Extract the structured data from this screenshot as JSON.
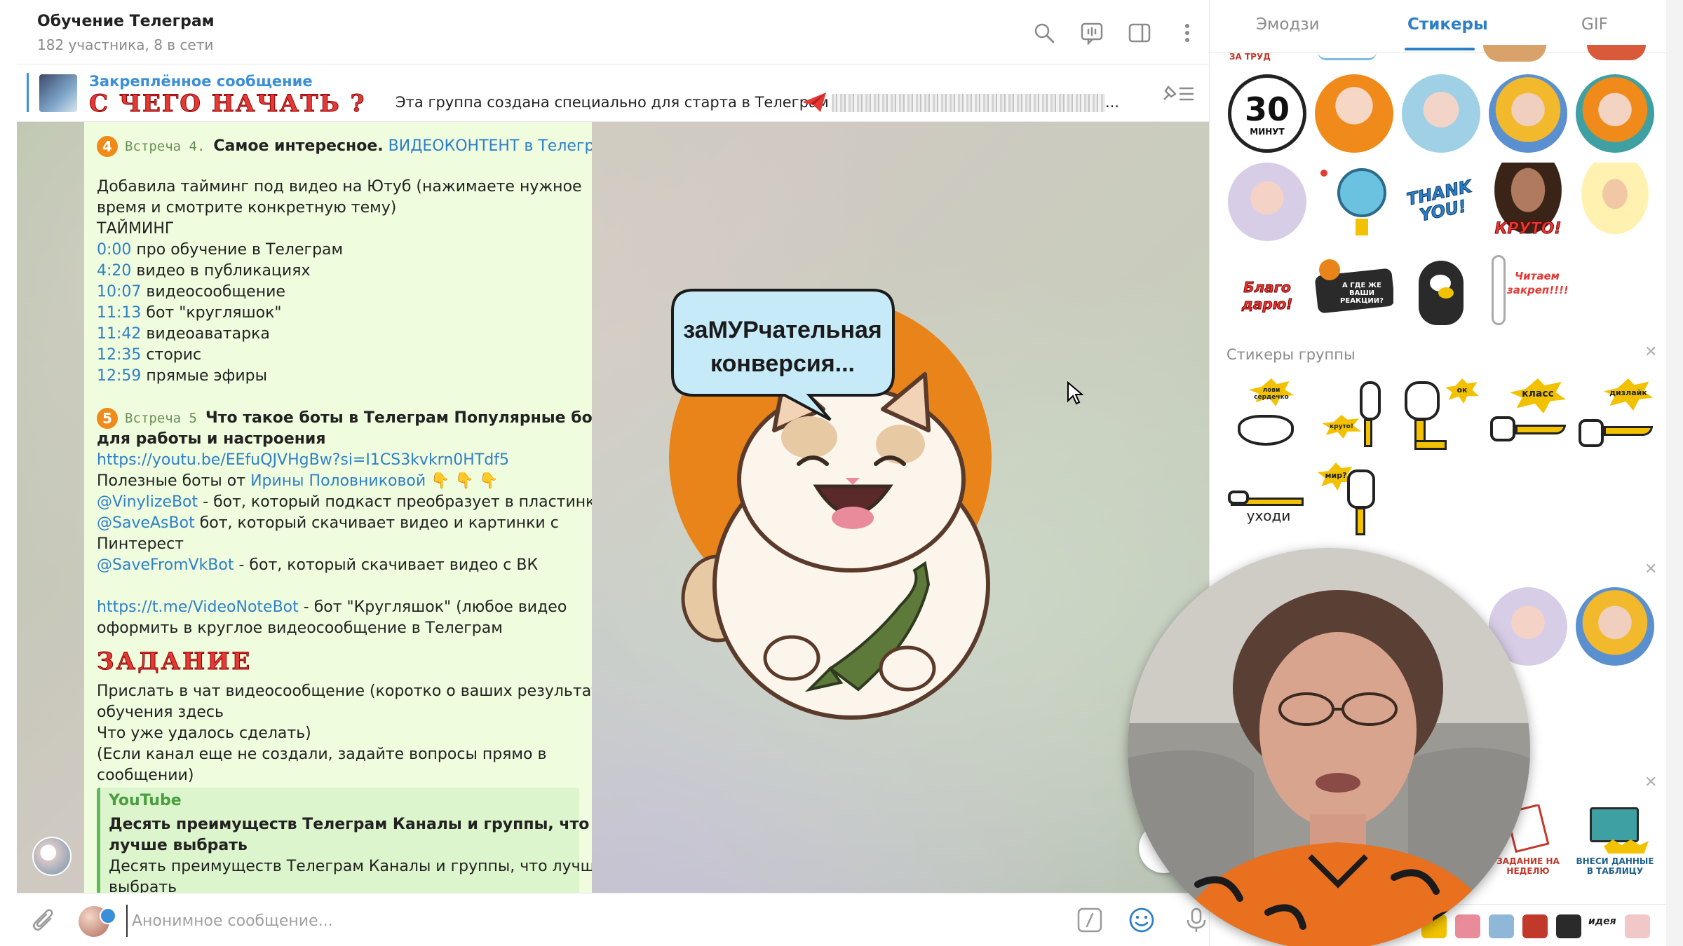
{
  "header": {
    "title": "Обучение Телеграм",
    "subtitle": "182 участника, 8 в сети"
  },
  "pinned": {
    "label": "Закреплённое сообщение",
    "headline": "С ЧЕГО НАЧАТЬ ?",
    "text": "Эта группа создана специально для старта в Телеграм",
    "ellipsis": "..."
  },
  "message": {
    "meet4_badge": "4",
    "meet4_label": "Встреча 4.",
    "meet4_title": "Самое интересное.",
    "meet4_link": "ВИДЕОКОНТЕНТ в Телеграм",
    "intro_1": "Добавила тайминг под видео на Ютуб (нажимаете нужное",
    "intro_2": "время и смотрите конкретную тему)",
    "timing_header": "ТАЙМИНГ",
    "timings": [
      {
        "time": "0:00",
        "text": "про обучение в Телеграм"
      },
      {
        "time": "4:20",
        "text": "видео в публикациях"
      },
      {
        "time": "10:07",
        "text": "видеосообщение"
      },
      {
        "time": "11:13",
        "text": "бот \"кругляшок\""
      },
      {
        "time": "11:42",
        "text": "видеоаватарка"
      },
      {
        "time": "12:35",
        "text": "сторис"
      },
      {
        "time": "12:59",
        "text": "прямые эфиры"
      }
    ],
    "meet5_badge": "5",
    "meet5_label": "Встреча 5",
    "meet5_title_1": "Что такое боты в Телеграм Популярные боты",
    "meet5_title_2": "для работы и настроения",
    "meet5_link": "https://youtu.be/EEfuQJVHgBw?si=I1CS3kvkrn0HTdf5",
    "useful_prefix": "Полезные боты от",
    "useful_link": "Ирины Половниковой",
    "useful_emoji": "👇 👇 👇",
    "bot1_link": "@VinylizeBot",
    "bot1_text": "- бот, который подкаст преобразует в пластинку",
    "bot2_link": "@SaveAsBot",
    "bot2_text": "бот, который скачивает видео и картинки с",
    "bot2_text_2": "Пинтерест",
    "bot3_link": "@SaveFromVkBot",
    "bot3_text": "- бот, который скачивает видео с ВК",
    "bot4_link": "https://t.me/VideoNoteBot",
    "bot4_text": "- бот \"Кругляшок\" (любое видео",
    "bot4_text_2": "оформить в круглое видеосообщение в Телеграм",
    "task_title": "ЗАДАНИЕ",
    "task_1": "Прислать в чат видеосообщение (коротко о ваших результатах",
    "task_2": "обучения здесь",
    "task_3": "Что уже удалось сделать)",
    "task_4": "(Если канал еще не создали, задайте вопросы прямо в",
    "task_5": "сообщении)",
    "preview_source": "YouTube",
    "preview_title_1": "Десять преимуществ Телеграм  Каналы и группы, что",
    "preview_title_2": "лучше выбрать",
    "preview_desc": "Десять преимуществ Телеграм  Каналы и группы, что лучше",
    "preview_desc_2": "выбрать"
  },
  "sticker": {
    "caption_1": "заМУРчательная",
    "caption_2": "конверсия..."
  },
  "input": {
    "placeholder": "Анонимное сообщение..."
  },
  "panel": {
    "tabs": [
      "Эмодзи",
      "Стикеры",
      "GIF"
    ],
    "active_tab": "Стикеры",
    "top_partial": "ЗА ТРУД",
    "sticker_30_number": "30",
    "sticker_30_unit": "МИНУТ",
    "sticker_thank": "THANK YOU!",
    "sticker_kruto": "КРУТО!",
    "sticker_blago": "Благо дарю!",
    "sticker_gde": "А ГДЕ ЖЕ ВАШИ РЕАКЦИИ?",
    "sticker_chitaem": "Читаем закреп!!!!",
    "group_title": "Стикеры группы",
    "group_stickers": [
      "лови сердечко",
      "ок",
      "класс",
      "дизлайк",
      "круто!",
      "мир?",
      "уходи"
    ],
    "sticker_zadanie": "ЗАДАНИЕ НА НЕДЕЛЮ",
    "sticker_vnesi": "ВНЕСИ ДАННЫЕ В ТАБЛИЦУ",
    "bottom_idea": "идея"
  },
  "colors": {
    "accent": "#2f7fc7",
    "message_bg": "#effdde",
    "orange": "#f08a1a",
    "red_title": "#e53935"
  }
}
